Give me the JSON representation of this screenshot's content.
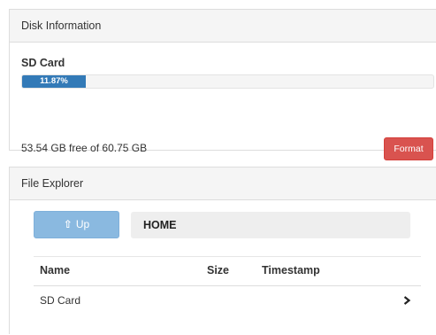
{
  "disk_panel": {
    "title": "Disk Information",
    "device_label": "SD Card",
    "usage_percent": 11.87,
    "usage_label": "11.87%",
    "free_text": "53.54 GB free of 60.75 GB",
    "format_button": "Format"
  },
  "file_panel": {
    "title": "File Explorer",
    "up_button": "Up",
    "up_icon": "arrow-up-icon",
    "current_path": "HOME",
    "columns": [
      "Name",
      "Size",
      "Timestamp"
    ],
    "rows": [
      {
        "name": "SD Card",
        "size": "",
        "timestamp": "",
        "icon": "chevron-right-icon"
      }
    ]
  },
  "colors": {
    "progress_fill": "#337ab7",
    "format_button": "#d9534f",
    "up_button": "#8ab9e0",
    "panel_heading": "#f5f5f5"
  }
}
